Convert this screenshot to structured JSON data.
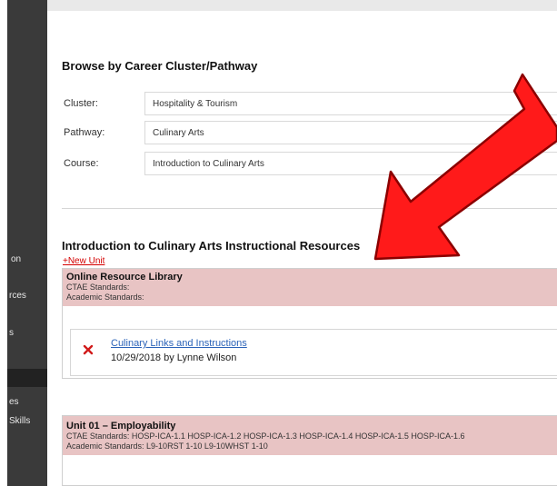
{
  "sidebar": {
    "items": [
      {
        "label": "on"
      },
      {
        "label": "rces"
      },
      {
        "label": "s"
      },
      {
        "label": ""
      },
      {
        "label": "es"
      },
      {
        "label": "Skills"
      }
    ]
  },
  "browse": {
    "title": "Browse by Career Cluster/Pathway",
    "cluster_label": "Cluster:",
    "cluster_value": "Hospitality & Tourism",
    "pathway_label": "Pathway:",
    "pathway_value": "Culinary Arts",
    "course_label": "Course:",
    "course_value": "Introduction to Culinary Arts"
  },
  "resources": {
    "title": "Introduction to Culinary Arts Instructional Resources",
    "new_unit": "+New Unit"
  },
  "library": {
    "title": "Online Resource Library",
    "ctae": "CTAE Standards:",
    "academic": "Academic Standards:"
  },
  "resource_item": {
    "link": "Culinary Links and Instructions",
    "meta": "10/29/2018 by Lynne Wilson"
  },
  "unit01": {
    "title": "Unit 01 – Employability",
    "ctae": "CTAE Standards: HOSP-ICA-1.1 HOSP-ICA-1.2 HOSP-ICA-1.3 HOSP-ICA-1.4 HOSP-ICA-1.5 HOSP-ICA-1.6",
    "academic": "Academic Standards: L9-10RST 1-10 L9-10WHST 1-10"
  },
  "colors": {
    "sidebar": "#3a3a3a",
    "unit_header": "#e8c4c4",
    "arrow": "#ff1a1a",
    "link": "#2b63b8",
    "new_unit": "#d40000"
  },
  "icons": {
    "delete": "close-icon",
    "annotation": "arrow-icon"
  }
}
